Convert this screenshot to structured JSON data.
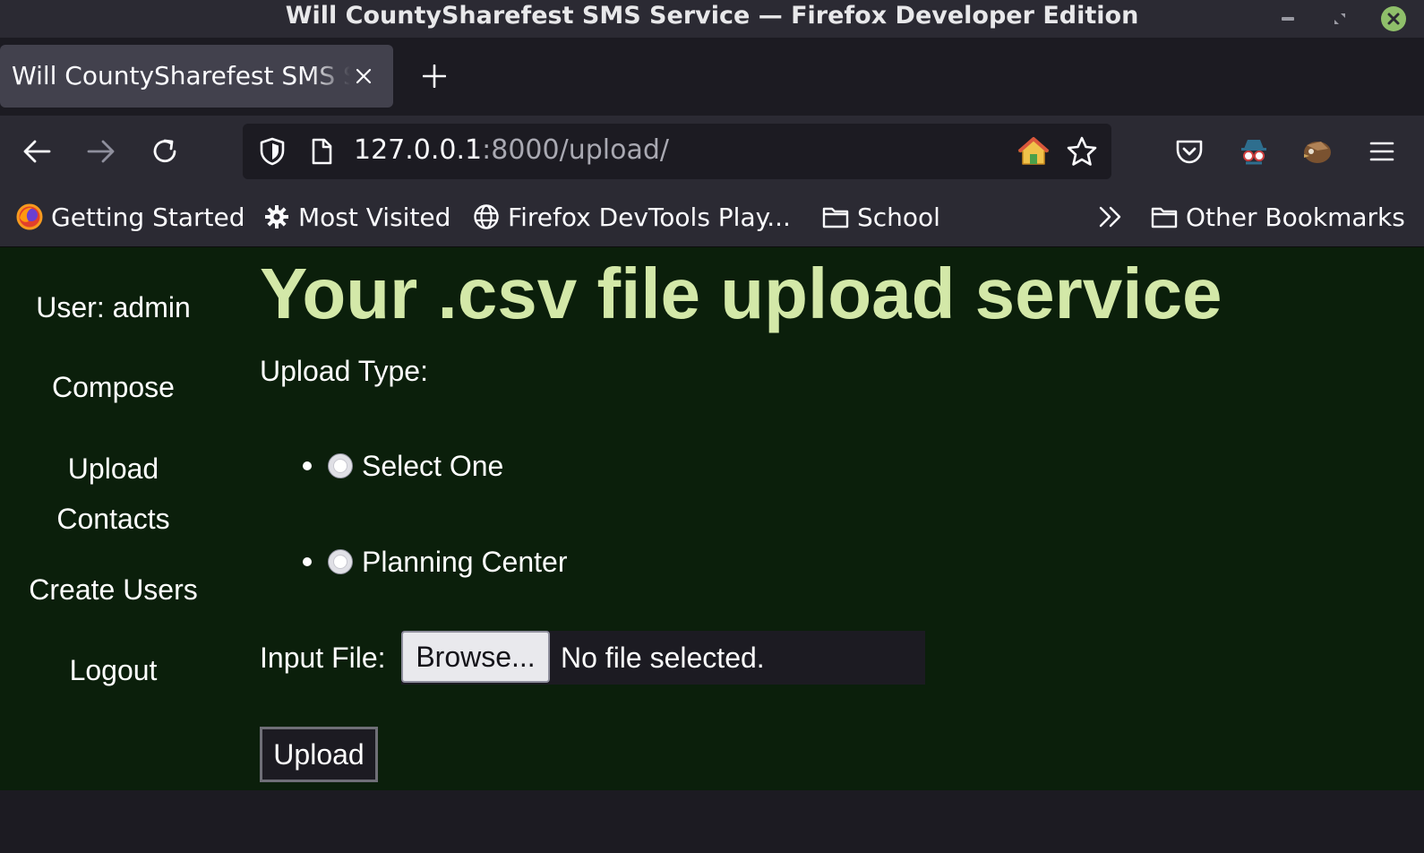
{
  "window": {
    "title": "Will CountySharefest SMS Service — Firefox Developer Edition"
  },
  "tabs": [
    {
      "title": "Will CountySharefest SMS Service",
      "active": true
    }
  ],
  "navbar": {
    "url_host": "127.0.0.1",
    "url_path": ":8000/upload/"
  },
  "bookmarks": {
    "items": [
      {
        "label": "Getting Started",
        "icon": "firefox-icon"
      },
      {
        "label": "Most Visited",
        "icon": "gear-icon"
      },
      {
        "label": "Firefox DevTools Play...",
        "icon": "globe-icon"
      },
      {
        "label": "School",
        "icon": "folder-icon"
      }
    ],
    "other": "Other Bookmarks"
  },
  "sidebar": {
    "user": "User: admin",
    "compose": "Compose",
    "upload_line1": "Upload",
    "upload_line2": "Contacts",
    "create_users": "Create Users",
    "logout": "Logout"
  },
  "main": {
    "title": "Your .csv file upload service",
    "upload_type_label": "Upload Type:",
    "radio_options": [
      {
        "label": "Select One",
        "selected": false
      },
      {
        "label": "Planning Center",
        "selected": false
      }
    ],
    "input_file_label": "Input File:",
    "browse_label": "Browse...",
    "file_status": "No file selected.",
    "upload_button": "Upload"
  },
  "colors": {
    "page_background": "#0b1f0b",
    "title_color": "#d3e8a8",
    "chrome_dark": "#1c1b22",
    "chrome_toolbar": "#2b2a33",
    "active_tab": "#42414d"
  }
}
